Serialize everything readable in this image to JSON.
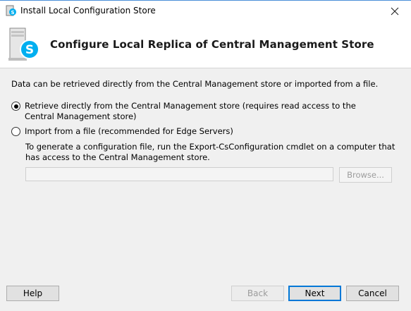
{
  "window": {
    "title": "Install Local Configuration Store",
    "app_icon": "skype-server-icon",
    "close_icon": "close-icon"
  },
  "header": {
    "title": "Configure Local Replica of Central Management Store",
    "logo": "skype-server-logo-icon"
  },
  "main": {
    "intro": "Data can be retrieved directly from the Central Management store or imported from a file.",
    "options": [
      {
        "label": "Retrieve directly from the Central Management store (requires read access to the Central Management store)",
        "selected": true
      },
      {
        "label": "Import from a file (recommended for Edge Servers)",
        "selected": false
      }
    ],
    "import_help": "To generate a configuration file, run the Export-CsConfiguration cmdlet on a computer that has access to the Central Management store.",
    "file_path_value": "",
    "browse_label": "Browse..."
  },
  "footer": {
    "help_label": "Help",
    "back_label": "Back",
    "next_label": "Next",
    "cancel_label": "Cancel"
  },
  "colors": {
    "accent": "#0078d7",
    "skype_blue": "#00aff0"
  }
}
